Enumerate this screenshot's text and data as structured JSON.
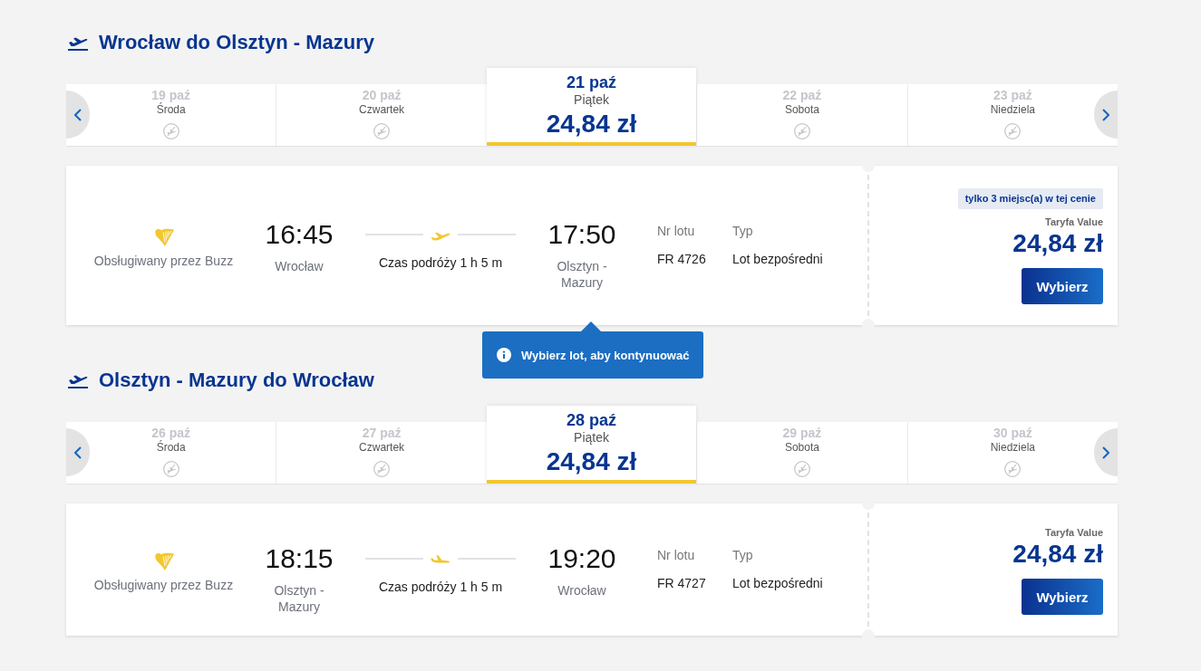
{
  "sections": [
    {
      "title": "Wrocław do Olsztyn - Mazury",
      "dates": [
        {
          "date": "19 paź",
          "day": "Środa",
          "selected": false
        },
        {
          "date": "20 paź",
          "day": "Czwartek",
          "selected": false
        },
        {
          "date": "21 paź",
          "day": "Piątek",
          "price": "24,84 zł",
          "selected": true
        },
        {
          "date": "22 paź",
          "day": "Sobota",
          "selected": false
        },
        {
          "date": "23 paź",
          "day": "Niedziela",
          "selected": false
        }
      ],
      "flights": [
        {
          "operator": "Obsługiwany przez Buzz",
          "departure_time": "16:45",
          "departure_city": "Wrocław",
          "duration": "Czas podróży 1 h 5 m",
          "arrival_time": "17:50",
          "arrival_city": "Olsztyn - Mazury",
          "flight_no_label": "Nr lotu",
          "flight_no": "FR 4726",
          "type_label": "Typ",
          "type": "Lot bezpośredni",
          "badge": "tylko 3 miejsc(a) w tej cenie",
          "fare": "Taryfa Value",
          "price": "24,84 zł",
          "button": "Wybierz"
        }
      ],
      "tooltip": "Wybierz lot, aby kontynuować"
    },
    {
      "title": "Olsztyn - Mazury do Wrocław",
      "dates": [
        {
          "date": "26 paź",
          "day": "Środa",
          "selected": false
        },
        {
          "date": "27 paź",
          "day": "Czwartek",
          "selected": false
        },
        {
          "date": "28 paź",
          "day": "Piątek",
          "price": "24,84 zł",
          "selected": true
        },
        {
          "date": "29 paź",
          "day": "Sobota",
          "selected": false
        },
        {
          "date": "30 paź",
          "day": "Niedziela",
          "selected": false
        }
      ],
      "flights": [
        {
          "operator": "Obsługiwany przez Buzz",
          "departure_time": "18:15",
          "departure_city": "Olsztyn - Mazury",
          "duration": "Czas podróży 1 h 5 m",
          "arrival_time": "19:20",
          "arrival_city": "Wrocław",
          "flight_no_label": "Nr lotu",
          "flight_no": "FR 4727",
          "type_label": "Typ",
          "type": "Lot bezpośredni",
          "fare": "Taryfa Value",
          "price": "24,84 zł",
          "button": "Wybierz"
        }
      ]
    }
  ]
}
